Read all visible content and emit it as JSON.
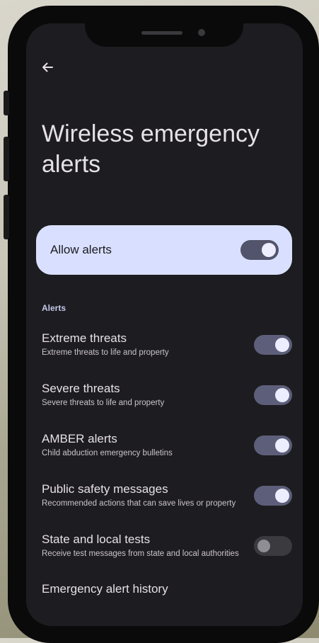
{
  "page": {
    "back_icon": "arrow-left-icon",
    "title": "Wireless emergency alerts"
  },
  "allow_alerts": {
    "label": "Allow alerts",
    "enabled": true
  },
  "section_header": "Alerts",
  "alerts": [
    {
      "title": "Extreme threats",
      "subtitle": "Extreme threats to life and property",
      "enabled": true
    },
    {
      "title": "Severe threats",
      "subtitle": "Severe threats to life and property",
      "enabled": true
    },
    {
      "title": "AMBER alerts",
      "subtitle": "Child abduction emergency bulletins",
      "enabled": true
    },
    {
      "title": "Public safety messages",
      "subtitle": "Recommended actions that can save lives or property",
      "enabled": true
    },
    {
      "title": "State and local tests",
      "subtitle": "Receive test messages from state and local authorities",
      "enabled": false
    }
  ],
  "history_link": "Emergency alert history",
  "colors": {
    "background": "#1d1c20",
    "card": "#d9e0ff",
    "toggle_on_track": "#5d5f7a",
    "toggle_on_knob": "#eceeff",
    "toggle_off_track": "#3a3a3f",
    "toggle_off_knob": "#8e8e94"
  }
}
